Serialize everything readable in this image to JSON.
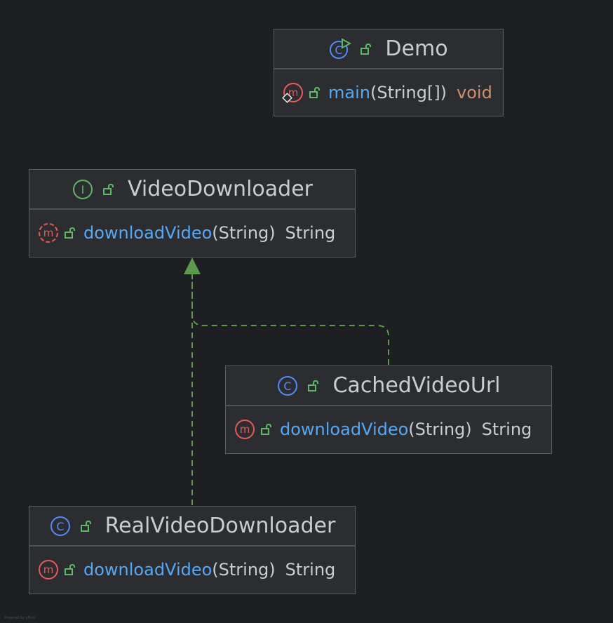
{
  "diagram": {
    "classes": [
      {
        "id": "demo",
        "kind": "class-runnable",
        "name": "Demo",
        "members": [
          {
            "name": "main",
            "params": "(String[])",
            "returns": "void",
            "icon": "method-static-icon"
          }
        ]
      },
      {
        "id": "video-downloader",
        "kind": "interface",
        "name": "VideoDownloader",
        "members": [
          {
            "name": "downloadVideo",
            "params": "(String)",
            "returns": "String",
            "icon": "abstract-method-icon"
          }
        ]
      },
      {
        "id": "cached-video-url",
        "kind": "class",
        "name": "CachedVideoUrl",
        "members": [
          {
            "name": "downloadVideo",
            "params": "(String)",
            "returns": "String",
            "icon": "method-icon"
          }
        ]
      },
      {
        "id": "real-video-downloader",
        "kind": "class",
        "name": "RealVideoDownloader",
        "members": [
          {
            "name": "downloadVideo",
            "params": "(String)",
            "returns": "String",
            "icon": "method-icon"
          }
        ]
      }
    ],
    "relations": [
      {
        "from": "cached-video-url",
        "to": "video-downloader",
        "type": "implements"
      },
      {
        "from": "real-video-downloader",
        "to": "video-downloader",
        "type": "implements"
      }
    ],
    "colors": {
      "background": "#1e1f22",
      "node_fill": "#2b2d30",
      "class_icon": "#548af7",
      "interface_icon": "#5fb865",
      "method_icon": "#e55b5b",
      "lock_icon": "#5fb865",
      "edge": "#5d9a4d",
      "method_name": "#56a8f5",
      "text": "#c9ccd1",
      "keyword": "#cf8e6d"
    },
    "footer": "Powered by yFiles"
  }
}
